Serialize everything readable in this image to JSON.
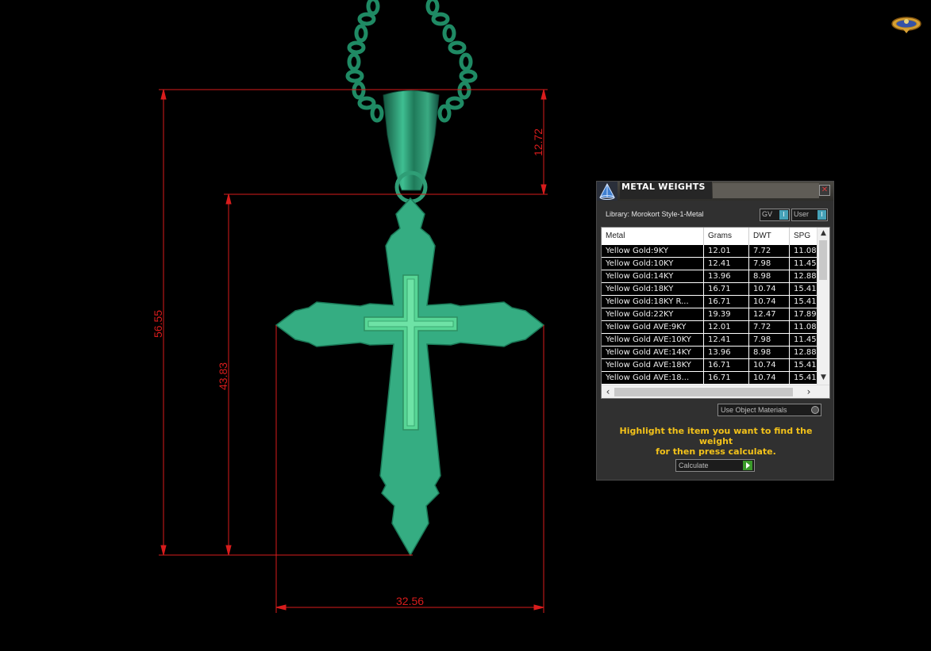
{
  "dimensions": {
    "total_height": "56.55",
    "body_height": "43.83",
    "bail_height": "12.72",
    "width": "32.56"
  },
  "panel": {
    "title": "METAL WEIGHTS",
    "close_icon": "close-icon",
    "library_label": "Library: Morokort Style-1-Metal",
    "toggle_gv": "GV",
    "toggle_user": "User",
    "columns": [
      "Metal",
      "Grams",
      "DWT",
      "SPG"
    ],
    "rows": [
      {
        "metal": "Yellow Gold:9KY",
        "grams": "12.01",
        "dwt": "7.72",
        "spg": "11.08"
      },
      {
        "metal": "Yellow Gold:10KY",
        "grams": "12.41",
        "dwt": "7.98",
        "spg": "11.45"
      },
      {
        "metal": "Yellow Gold:14KY",
        "grams": "13.96",
        "dwt": "8.98",
        "spg": "12.88"
      },
      {
        "metal": "Yellow Gold:18KY",
        "grams": "16.71",
        "dwt": "10.74",
        "spg": "15.41"
      },
      {
        "metal": "Yellow Gold:18KY R...",
        "grams": "16.71",
        "dwt": "10.74",
        "spg": "15.41"
      },
      {
        "metal": "Yellow Gold:22KY",
        "grams": "19.39",
        "dwt": "12.47",
        "spg": "17.89"
      },
      {
        "metal": "Yellow Gold AVE:9KY",
        "grams": "12.01",
        "dwt": "7.72",
        "spg": "11.08"
      },
      {
        "metal": "Yellow Gold AVE:10KY",
        "grams": "12.41",
        "dwt": "7.98",
        "spg": "11.45"
      },
      {
        "metal": "Yellow Gold AVE:14KY",
        "grams": "13.96",
        "dwt": "8.98",
        "spg": "12.88"
      },
      {
        "metal": "Yellow Gold AVE:18KY",
        "grams": "16.71",
        "dwt": "10.74",
        "spg": "15.41"
      },
      {
        "metal": "Yellow Gold AVE:18...",
        "grams": "16.71",
        "dwt": "10.74",
        "spg": "15.41"
      }
    ],
    "use_object_materials": "Use Object Materials",
    "hint_line1": "Highlight the item you want to find the weight",
    "hint_line2": "for then press calculate.",
    "calculate_label": "Calculate"
  },
  "colors": {
    "dimension_red": "#d81c1c",
    "model_green": "#35ad82",
    "hint_yellow": "#f3c21a"
  }
}
